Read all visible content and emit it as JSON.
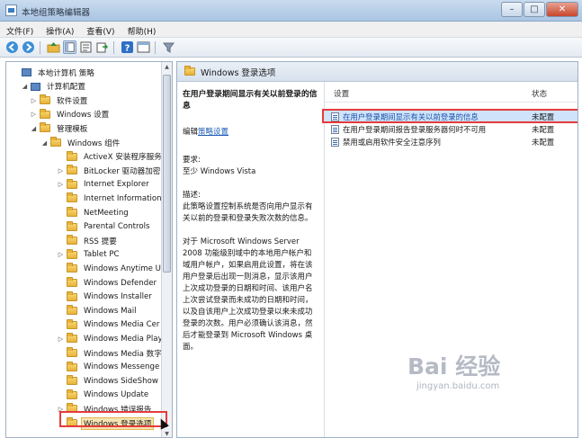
{
  "window": {
    "title": "本地组策略编辑器",
    "minimize": "–",
    "maximize": "□",
    "close": "✕"
  },
  "menu": [
    "文件(F)",
    "操作(A)",
    "查看(V)",
    "帮助(H)"
  ],
  "tree": {
    "items": [
      {
        "label": "本地计算机 策略",
        "indent": 0,
        "toggle": "",
        "icon": "computer"
      },
      {
        "label": "计算机配置",
        "indent": 1,
        "toggle": "◢",
        "icon": "computer"
      },
      {
        "label": "软件设置",
        "indent": 2,
        "toggle": "▷",
        "icon": "folder"
      },
      {
        "label": "Windows 设置",
        "indent": 2,
        "toggle": "▷",
        "icon": "folder"
      },
      {
        "label": "管理模板",
        "indent": 2,
        "toggle": "◢",
        "icon": "folder"
      },
      {
        "label": "Windows 组件",
        "indent": 3,
        "toggle": "◢",
        "icon": "folder"
      },
      {
        "label": "ActiveX 安装程序服务",
        "indent": 4,
        "toggle": "",
        "icon": "folder"
      },
      {
        "label": "BitLocker 驱动器加密",
        "indent": 4,
        "toggle": "▷",
        "icon": "folder"
      },
      {
        "label": "Internet Explorer",
        "indent": 4,
        "toggle": "▷",
        "icon": "folder"
      },
      {
        "label": "Internet Information",
        "indent": 4,
        "toggle": "",
        "icon": "folder"
      },
      {
        "label": "NetMeeting",
        "indent": 4,
        "toggle": "",
        "icon": "folder"
      },
      {
        "label": "Parental Controls",
        "indent": 4,
        "toggle": "",
        "icon": "folder"
      },
      {
        "label": "RSS 提要",
        "indent": 4,
        "toggle": "",
        "icon": "folder"
      },
      {
        "label": "Tablet PC",
        "indent": 4,
        "toggle": "▷",
        "icon": "folder"
      },
      {
        "label": "Windows Anytime U",
        "indent": 4,
        "toggle": "",
        "icon": "folder"
      },
      {
        "label": "Windows Defender",
        "indent": 4,
        "toggle": "",
        "icon": "folder"
      },
      {
        "label": "Windows Installer",
        "indent": 4,
        "toggle": "",
        "icon": "folder"
      },
      {
        "label": "Windows Mail",
        "indent": 4,
        "toggle": "",
        "icon": "folder"
      },
      {
        "label": "Windows Media Cer",
        "indent": 4,
        "toggle": "",
        "icon": "folder"
      },
      {
        "label": "Windows Media Play",
        "indent": 4,
        "toggle": "▷",
        "icon": "folder"
      },
      {
        "label": "Windows Media 数字",
        "indent": 4,
        "toggle": "",
        "icon": "folder"
      },
      {
        "label": "Windows Messenge",
        "indent": 4,
        "toggle": "",
        "icon": "folder"
      },
      {
        "label": "Windows SideShow",
        "indent": 4,
        "toggle": "",
        "icon": "folder"
      },
      {
        "label": "Windows Update",
        "indent": 4,
        "toggle": "",
        "icon": "folder"
      },
      {
        "label": "Windows 错误报告",
        "indent": 4,
        "toggle": "▷",
        "icon": "folder"
      },
      {
        "label": "Windows 登录选项",
        "indent": 4,
        "toggle": "",
        "icon": "folder",
        "selected": true
      }
    ]
  },
  "content": {
    "title": "Windows 登录选项",
    "description": {
      "title": "在用户登录期间显示有关以前登录的信息",
      "edit_prefix": "编辑",
      "edit_link": "策略设置",
      "requirement_label": "要求:",
      "requirement_value": "至少 Windows Vista",
      "desc_label": "描述:",
      "desc_text": "此策略设置控制系统是否向用户显示有关以前的登录和登录失败次数的信息。",
      "detail_text": "对于 Microsoft Windows Server 2008 功能级别域中的本地用户帐户和域用户帐户，如果启用此设置，将在该用户登录后出现一则消息，显示该用户上次成功登录的日期和时间、该用户名上次尝试登录而未成功的日期和时间，以及自该用户上次成功登录以来未成功登录的次数。用户必须确认该消息，然后才能登录到 Microsoft Windows 桌面。"
    },
    "list": {
      "col_setting": "设置",
      "col_status": "状态",
      "rows": [
        {
          "setting": "在用户登录期间显示有关以前登录的信息",
          "status": "未配置",
          "selected": true
        },
        {
          "setting": "在用户登录期间报告登录服务器何时不可用",
          "status": "未配置"
        },
        {
          "setting": "禁用或启用软件安全注意序列",
          "status": "未配置"
        }
      ]
    }
  },
  "watermark": {
    "logo": "Bai 经验",
    "url": "jingyan.baidu.com"
  },
  "colors": {
    "highlight": "#e43b3b",
    "selection": "#cfe3fb",
    "link": "#1d5bb8"
  }
}
